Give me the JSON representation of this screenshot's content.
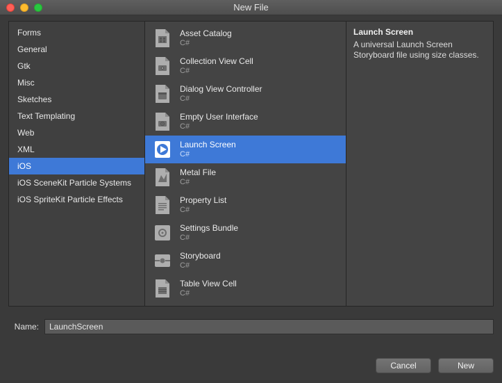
{
  "window": {
    "title": "New File"
  },
  "categories": [
    {
      "label": "Forms",
      "selected": false
    },
    {
      "label": "General",
      "selected": false
    },
    {
      "label": "Gtk",
      "selected": false
    },
    {
      "label": "Misc",
      "selected": false
    },
    {
      "label": "Sketches",
      "selected": false
    },
    {
      "label": "Text Templating",
      "selected": false
    },
    {
      "label": "Web",
      "selected": false
    },
    {
      "label": "XML",
      "selected": false
    },
    {
      "label": "iOS",
      "selected": true
    },
    {
      "label": "iOS SceneKit Particle Systems",
      "selected": false
    },
    {
      "label": "iOS SpriteKit Particle Effects",
      "selected": false
    }
  ],
  "templates": [
    {
      "name": "Asset Catalog",
      "sub": "C#",
      "icon": "asset-catalog-icon",
      "selected": false
    },
    {
      "name": "Collection View Cell",
      "sub": "C#",
      "icon": "collection-view-icon",
      "selected": false
    },
    {
      "name": "Dialog View Controller",
      "sub": "C#",
      "icon": "dialog-view-icon",
      "selected": false
    },
    {
      "name": "Empty User Interface",
      "sub": "C#",
      "icon": "empty-ui-icon",
      "selected": false
    },
    {
      "name": "Launch Screen",
      "sub": "C#",
      "icon": "launch-screen-icon",
      "selected": true
    },
    {
      "name": "Metal File",
      "sub": "C#",
      "icon": "metal-file-icon",
      "selected": false
    },
    {
      "name": "Property List",
      "sub": "C#",
      "icon": "property-list-icon",
      "selected": false
    },
    {
      "name": "Settings Bundle",
      "sub": "C#",
      "icon": "settings-bundle-icon",
      "selected": false
    },
    {
      "name": "Storyboard",
      "sub": "C#",
      "icon": "storyboard-icon",
      "selected": false
    },
    {
      "name": "Table View Cell",
      "sub": "C#",
      "icon": "table-view-icon",
      "selected": false
    }
  ],
  "description": {
    "title": "Launch Screen",
    "body": "A universal Launch Screen Storyboard file using size classes."
  },
  "name_field": {
    "label": "Name:",
    "value": "LaunchScreen"
  },
  "buttons": {
    "cancel": "Cancel",
    "new": "New"
  },
  "colors": {
    "selection": "#3e79d7"
  }
}
